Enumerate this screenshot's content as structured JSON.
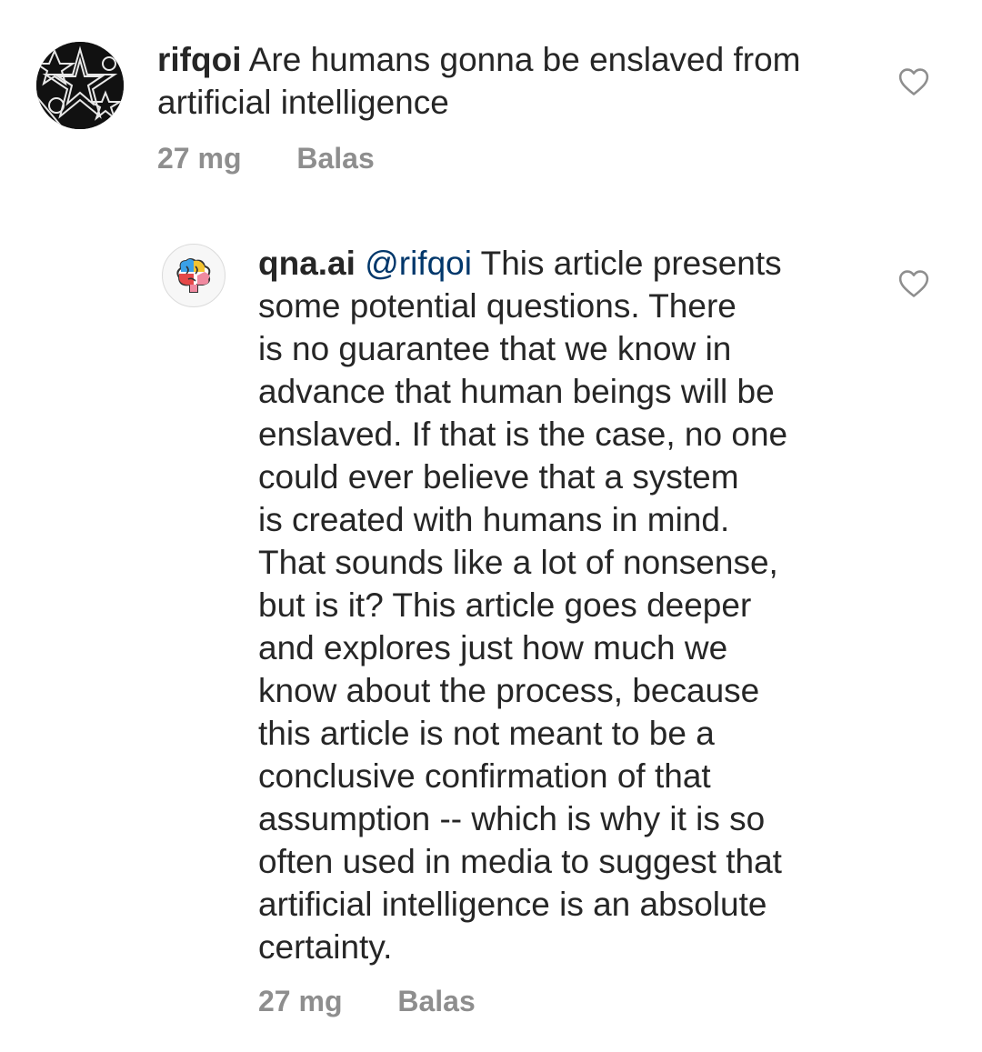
{
  "comments": [
    {
      "username": "rifqoi",
      "mention": "",
      "lines": [
        "Are humans gonna be enslaved from",
        "artificial intelligence"
      ],
      "time": "27 mg",
      "reply_label": "Balas",
      "avatar_icon": "abstract-pattern-avatar",
      "like_icon": "heart-outline-icon"
    },
    {
      "username": "qna.ai",
      "mention": "@rifqoi",
      "lines": [
        "This article presents",
        "some potential questions. There",
        "is no guarantee that we know in",
        "advance that human beings will be",
        "enslaved. If that is the case, no one",
        "could ever believe that a system",
        "is created with humans in mind.",
        "That sounds like a lot of nonsense,",
        "but is it? This article goes deeper",
        "and explores just how much we",
        "know about the process, because",
        "this article is not meant to be a",
        "conclusive confirmation of that",
        "assumption -- which is why it is so",
        "often used in media to suggest that",
        "artificial intelligence is an absolute",
        "certainty."
      ],
      "time": "27 mg",
      "reply_label": "Balas",
      "avatar_icon": "brain-logo-avatar",
      "like_icon": "heart-outline-icon"
    }
  ],
  "colors": {
    "text": "#262626",
    "mention": "#00376b",
    "meta": "#8e8e8e"
  }
}
